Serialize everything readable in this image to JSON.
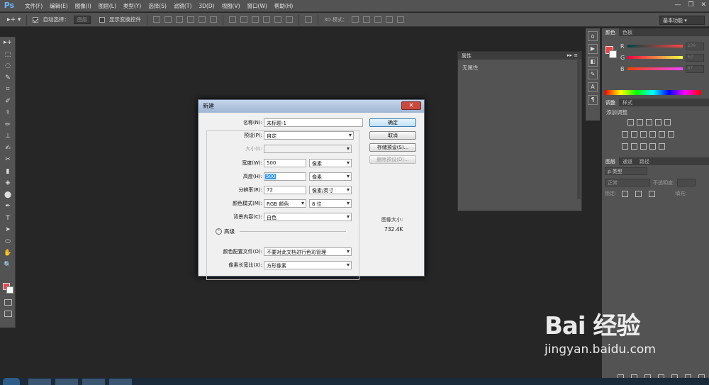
{
  "app": {
    "logo": "Ps"
  },
  "menu": [
    "文件(F)",
    "编辑(E)",
    "图像(I)",
    "图层(L)",
    "类型(Y)",
    "选择(S)",
    "滤镜(T)",
    "3D(D)",
    "视图(V)",
    "窗口(W)",
    "帮助(H)"
  ],
  "window_controls": {
    "minimize": "—",
    "restore": "❐",
    "close": "✕"
  },
  "options": {
    "auto_select_label": "自动选择：",
    "auto_select_value": "图层",
    "show_transform_label": "显示变换控件",
    "mode_3d_label": "3D 模式：",
    "workspace": "基本功能"
  },
  "tools": [
    "▸+",
    "⬚",
    "◌",
    "✎",
    "⌗",
    "✐",
    "⚕",
    "✏",
    "⊥",
    "✍",
    "✂",
    "▮",
    "◈",
    "⬤",
    "✒",
    "T",
    "➤",
    "⬭",
    "✋",
    "🔍"
  ],
  "color_panel": {
    "tabs": [
      "颜色",
      "色板"
    ],
    "channels": [
      {
        "name": "R",
        "value": "239"
      },
      {
        "name": "G",
        "value": "67"
      },
      {
        "name": "B",
        "value": "67"
      }
    ],
    "fg_color": "#ef4343"
  },
  "adjust_panel": {
    "tabs": [
      "调整",
      "样式"
    ],
    "title": "添加调整"
  },
  "layers_panel": {
    "tabs": [
      "图层",
      "通道",
      "路径"
    ],
    "filter": "ρ 类型",
    "blend": "正常",
    "opacity_label": "不透明度:",
    "lock_label": "锁定:",
    "fill_label": "填充:"
  },
  "properties_panel": {
    "title": "属性",
    "empty_text": "无属性"
  },
  "dialog": {
    "title": "新建",
    "name_label": "名称(N):",
    "name_value": "未标题-1",
    "preset_label": "预设(P):",
    "preset_value": "自定",
    "size_label": "大小(I):",
    "width_label": "宽度(W):",
    "width_value": "500",
    "width_unit": "像素",
    "height_label": "高度(H):",
    "height_value": "500",
    "height_unit": "像素",
    "resolution_label": "分辨率(R):",
    "resolution_value": "72",
    "resolution_unit": "像素/英寸",
    "color_mode_label": "颜色模式(M):",
    "color_mode_value": "RGB 颜色",
    "bit_depth_value": "8 位",
    "background_label": "背景内容(C):",
    "background_value": "白色",
    "advanced_label": "高级",
    "color_profile_label": "颜色配置文件(O):",
    "color_profile_value": "不要对此文档进行色彩管理",
    "pixel_aspect_label": "像素长宽比(X):",
    "pixel_aspect_value": "方形像素",
    "ok": "确定",
    "cancel": "取消",
    "save_preset": "存储预设(S)...",
    "delete_preset": "删除预设(D)...",
    "image_size_label": "图像大小:",
    "image_size_value": "732.4K"
  },
  "watermark": {
    "main": "Bai 经验",
    "sub": "jingyan.baidu.com"
  }
}
